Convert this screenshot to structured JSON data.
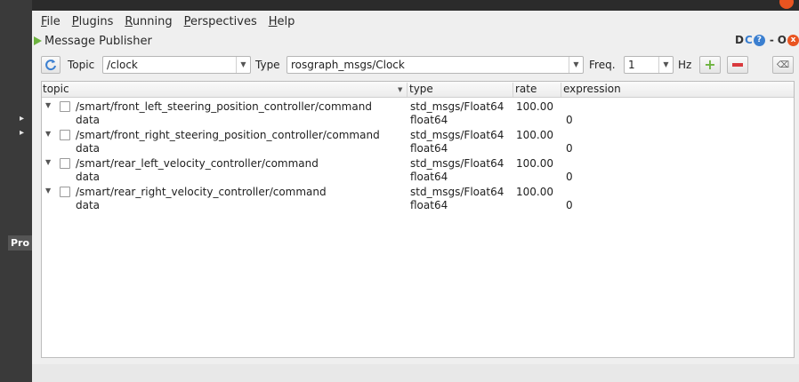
{
  "sidebar_strip": {
    "label": "Pro"
  },
  "menubar": {
    "items": [
      {
        "accel": "F",
        "rest": "ile"
      },
      {
        "accel": "P",
        "rest": "lugins"
      },
      {
        "accel": "R",
        "rest": "unning"
      },
      {
        "accel": "P",
        "pre": "",
        "rest": "erspectives"
      },
      {
        "accel": "H",
        "rest": "elp"
      }
    ],
    "labels": [
      "File",
      "Plugins",
      "Running",
      "Perspectives",
      "Help"
    ]
  },
  "plugin": {
    "title": "Message Publisher",
    "ctrl_d": "D",
    "ctrl_c": "C",
    "ctrl_help": "?",
    "ctrl_min": "-",
    "ctrl_o": "O",
    "ctrl_close": "x"
  },
  "toolbar": {
    "topic_label": "Topic",
    "topic_value": "/clock",
    "type_label": "Type",
    "type_value": "rosgraph_msgs/Clock",
    "freq_label": "Freq.",
    "freq_value": "1",
    "hz_label": "Hz",
    "add_symbol": "+",
    "remove_symbol": "−",
    "clear_symbol": "⌫"
  },
  "table": {
    "columns": [
      "topic",
      "type",
      "rate",
      "expression"
    ],
    "rows": [
      {
        "topic": "/smart/front_left_steering_position_controller/command",
        "type": "std_msgs/Float64",
        "rate": "100.00",
        "expression": "",
        "child": {
          "name": "data",
          "type": "float64",
          "expression": "0"
        }
      },
      {
        "topic": "/smart/front_right_steering_position_controller/command",
        "type": "std_msgs/Float64",
        "rate": "100.00",
        "expression": "",
        "child": {
          "name": "data",
          "type": "float64",
          "expression": "0"
        }
      },
      {
        "topic": "/smart/rear_left_velocity_controller/command",
        "type": "std_msgs/Float64",
        "rate": "100.00",
        "expression": "",
        "child": {
          "name": "data",
          "type": "float64",
          "expression": "0"
        }
      },
      {
        "topic": "/smart/rear_right_velocity_controller/command",
        "type": "std_msgs/Float64",
        "rate": "100.00",
        "expression": "",
        "child": {
          "name": "data",
          "type": "float64",
          "expression": "0"
        }
      }
    ]
  },
  "colors": {
    "accent_green": "#6db33f",
    "remove_red": "#d9393d",
    "refresh_blue": "#3b7fd0",
    "close_orange": "#e95420"
  }
}
